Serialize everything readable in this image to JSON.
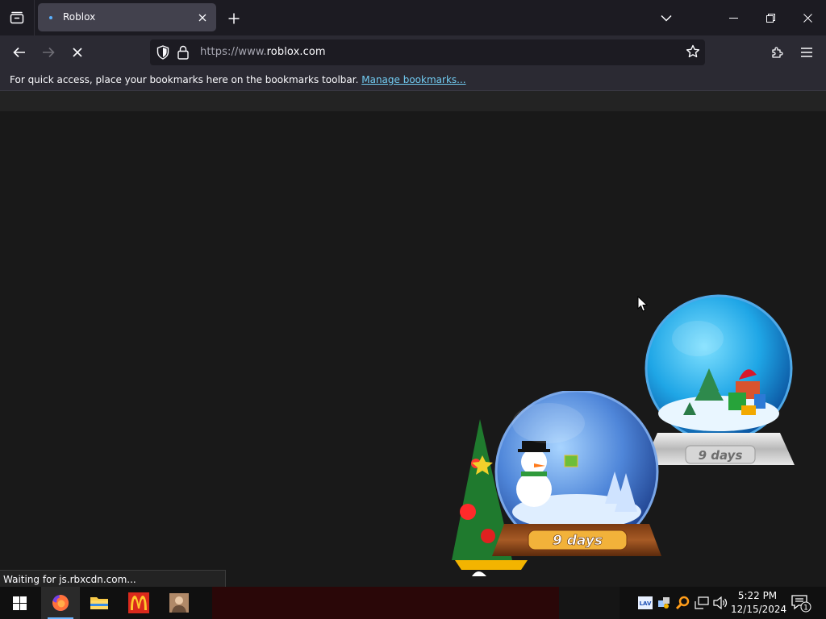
{
  "browser": {
    "tab": {
      "title": "Roblox"
    },
    "url": {
      "scheme": "https://www.",
      "host": "roblox.com"
    },
    "bookmarks_bar": {
      "message": "For quick access, place your bookmarks here on the bookmarks toolbar.",
      "link": "Manage bookmarks..."
    },
    "status_text": "Waiting for js.rbxcdn.com..."
  },
  "widgets": {
    "big_globe_label": "9 days",
    "small_globe_label": "9 days"
  },
  "taskbar": {
    "apps": [
      "firefox-icon",
      "file-explorer-icon",
      "mcdonalds-icon",
      "photo-icon"
    ],
    "clock_time": "5:22 PM",
    "clock_date": "12/15/2024",
    "notification_count": "1",
    "tray_label_lav": "LAV"
  },
  "colors": {
    "accent_link": "#72cdf4",
    "tab_active": "#42414d",
    "content_bg": "#191919",
    "taskbar_band": "#2a0708"
  }
}
